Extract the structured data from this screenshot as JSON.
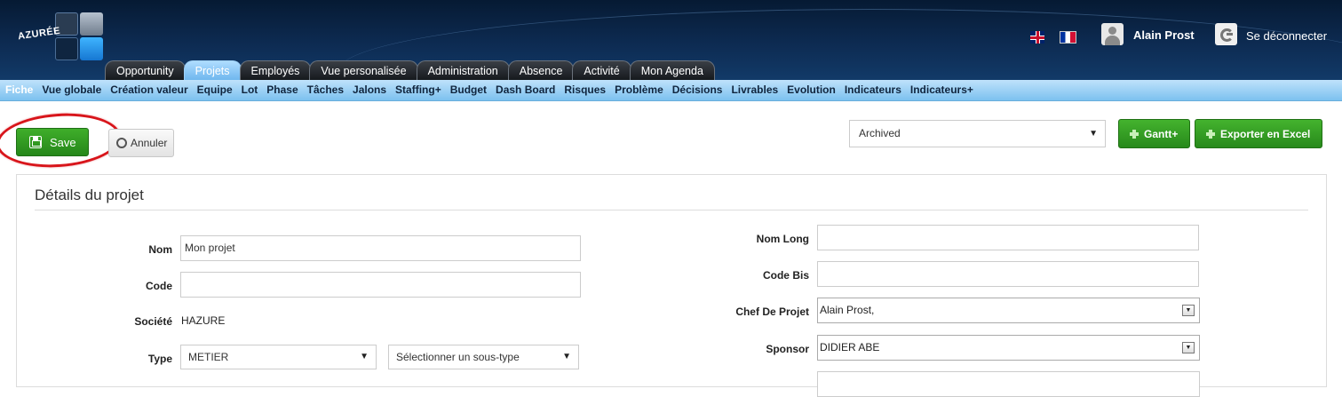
{
  "brand": {
    "logo_text": "AZURÉE"
  },
  "user": {
    "name": "Alain Prost",
    "logout_label": "Se déconnecter"
  },
  "main_tabs": [
    "Opportunity",
    "Projets",
    "Employés",
    "Vue personalisée",
    "Administration",
    "Absence",
    "Activité",
    "Mon Agenda"
  ],
  "active_main_tab": "Projets",
  "sub_nav": [
    "Fiche",
    "Vue globale",
    "Création valeur",
    "Equipe",
    "Lot",
    "Phase",
    "Tâches",
    "Jalons",
    "Staffing+",
    "Budget",
    "Dash Board",
    "Risques",
    "Problème",
    "Décisions",
    "Livrables",
    "Evolution",
    "Indicateurs",
    "Indicateurs+"
  ],
  "active_sub_nav": "Fiche",
  "toolbar": {
    "save_label": "Save",
    "cancel_label": "Annuler",
    "status_value": "Archived",
    "gantt_label": "Gantt+",
    "excel_label": "Exporter en Excel"
  },
  "panel": {
    "title": "Détails du projet",
    "left": {
      "nom_label": "Nom",
      "nom_value": "Mon projet",
      "code_label": "Code",
      "code_value": "",
      "societe_label": "Société",
      "societe_value": "HAZURE",
      "type_label": "Type",
      "type_value": "METIER",
      "subtype_value": "Sélectionner un sous-type"
    },
    "right": {
      "nom_long_label": "Nom Long",
      "nom_long_value": "",
      "code_bis_label": "Code Bis",
      "code_bis_value": "",
      "chef_label": "Chef De Projet",
      "chef_value": "Alain Prost,",
      "sponsor_label": "Sponsor",
      "sponsor_value": "DIDIER ABE"
    }
  },
  "colors": {
    "header": "#0d2b52",
    "subnav": "#9fd2f5",
    "green": "#2f9a22",
    "highlight_circle": "#d8151b"
  },
  "icons": [
    "uk-flag-icon",
    "fr-flag-icon",
    "user-icon",
    "logout-icon",
    "floppy-disk-icon",
    "cancel-icon",
    "plus-icon",
    "chevron-down-icon"
  ]
}
